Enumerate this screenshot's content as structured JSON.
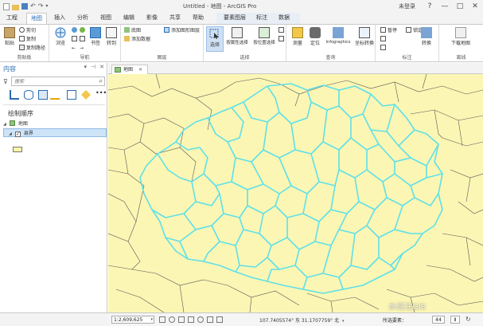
{
  "titlebar": {
    "title": "Untitled - 地图 - ArcGIS Pro",
    "login": "未登录",
    "help": "?",
    "minimize": "—",
    "maximize": "□",
    "close": "✕"
  },
  "tabs": [
    {
      "label": "工程"
    },
    {
      "label": "地图"
    },
    {
      "label": "插入"
    },
    {
      "label": "分析"
    },
    {
      "label": "视图"
    },
    {
      "label": "编辑"
    },
    {
      "label": "影像"
    },
    {
      "label": "共享"
    },
    {
      "label": "帮助"
    },
    {
      "label": "要素图层"
    },
    {
      "label": "标注"
    },
    {
      "label": "数据"
    }
  ],
  "ribbon": {
    "clipboard": {
      "label": "剪贴板",
      "paste": "粘贴",
      "cut": "剪切",
      "copy": "复制",
      "copy_path": "复制路径"
    },
    "navigate": {
      "label": "导航",
      "explore": "浏览",
      "bookmarks": "书签",
      "goto": "转到"
    },
    "layer": {
      "label": "图层",
      "basemap": "底图",
      "add_data": "添加数据",
      "add_graphics": "添加图形图层"
    },
    "selection": {
      "label": "选择",
      "select": "选择",
      "by_attr": "按属性选择",
      "by_loc": "按位置选择"
    },
    "inquiry": {
      "label": "查询",
      "measure": "测量",
      "locate": "定位",
      "infographics": "Infographics",
      "coord_convert": "坐标转换"
    },
    "labeling": {
      "label": "标注",
      "pause": "暂停",
      "lock": "锁定",
      "convert": "转换"
    },
    "offline": {
      "label": "离线",
      "download_map": "下载地图"
    }
  },
  "contents": {
    "title": "内容",
    "search_placeholder": "搜索",
    "draw_order": "绘制顺序",
    "map_node": "地图",
    "layer_node": "县界"
  },
  "map_view": {
    "tab_label": "地图",
    "tab_close": "✕"
  },
  "status": {
    "scale": "1:2,609,625",
    "coords": "107.7405574° 东 31.1707759° 北",
    "selected_label": "所选要素：",
    "selected_count": "44",
    "pause": "Ⅱ",
    "refresh": "↻"
  },
  "watermark": "水经注GIS",
  "colors": {
    "accent": "#2a6db5",
    "map_fill": "#fbf6b4",
    "selection": "#5fe0e8",
    "boundary": "#555555"
  }
}
